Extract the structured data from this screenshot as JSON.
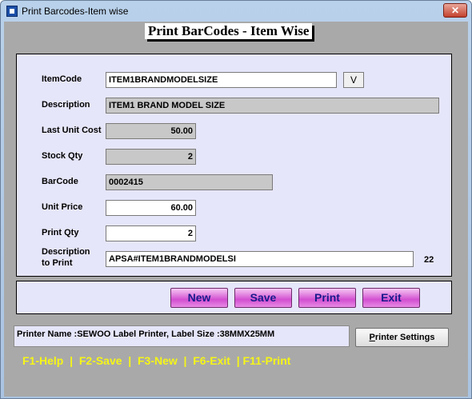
{
  "window": {
    "title": "Print Barcodes-Item wise",
    "close_glyph": "✕"
  },
  "heading": "Print BarCodes - Item Wise",
  "form": {
    "item_code": {
      "label": "ItemCode",
      "value": "ITEM1BRANDMODELSIZE",
      "picker_label": "V"
    },
    "description": {
      "label": "Description",
      "value": "ITEM1 BRAND MODEL SIZE"
    },
    "last_unit_cost": {
      "label": "Last Unit Cost",
      "value": "50.00"
    },
    "stock_qty": {
      "label": "Stock Qty",
      "value": "2"
    },
    "barcode": {
      "label": "BarCode",
      "value": "0002415"
    },
    "unit_price": {
      "label": "Unit Price",
      "value": "60.00"
    },
    "print_qty": {
      "label": "Print Qty",
      "value": "2"
    },
    "description_to_print": {
      "label_line1": "Description",
      "label_line2": "to Print",
      "value": "APSA#ITEM1BRANDMODELSI",
      "length": "22"
    }
  },
  "buttons": {
    "new": "New",
    "save": "Save",
    "print": "Print",
    "exit": "Exit"
  },
  "status": {
    "printer_info": "Printer Name :SEWOO Label Printer,  Label Size :38MMX25MM"
  },
  "printer_settings": {
    "first_letter": "P",
    "rest": "rinter Settings"
  },
  "hotkeys": "F1-Help  |  F2-Save  |  F3-New  |  F6-Exit  | F11-Print",
  "colors": {
    "client_bg": "#a9a9a9",
    "panel_bg": "#e6e6fa",
    "action_button": "#d24fd0",
    "hotkey_text": "#f5f518"
  },
  "icons": {
    "app": "app-icon",
    "close": "close-icon"
  }
}
